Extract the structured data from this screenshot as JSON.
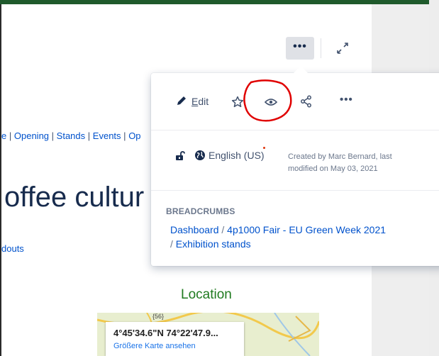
{
  "toolbar": {
    "more_label": "•••",
    "expand_icon": "expand-arrows-icon"
  },
  "page": {
    "nav": [
      "e",
      "Opening",
      "Stands",
      "Events",
      "Op"
    ],
    "nav_separator": "|",
    "heading_partial": "offee cultur",
    "handouts_partial": "douts",
    "location_label": "Location",
    "map": {
      "coords": "4°45'34.6\"N 74°22'47.9...",
      "link": "Größere Karte ansehen",
      "route_label": "{56}"
    }
  },
  "popup": {
    "edit_label_u": "E",
    "edit_label_rest": "dit",
    "more_label": "•••",
    "language": "English (US)",
    "created_text": "Created by Marc Bernard, last modified on May 03, 2021",
    "breadcrumbs": {
      "title": "BREADCRUMBS",
      "items": [
        "Dashboard",
        "4p1000 Fair - EU Green Week 2021",
        "Exhibition stands"
      ],
      "separator": "/"
    }
  },
  "colors": {
    "link": "#0052cc",
    "text": "#172b4d",
    "annotation": "#e00000",
    "location": "#1f7a1f"
  }
}
